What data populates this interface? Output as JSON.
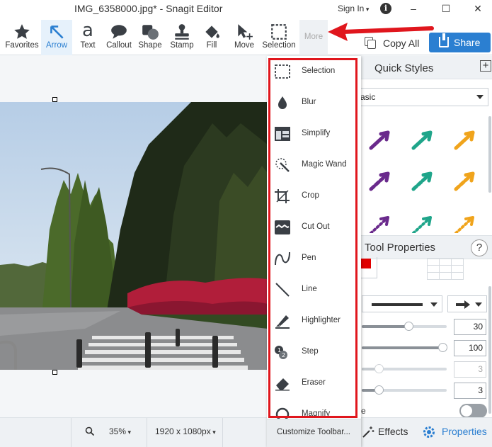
{
  "window": {
    "title": "IMG_6358000.jpg* - Snagit Editor",
    "sign_in": "Sign In"
  },
  "toolbar": {
    "tools": [
      {
        "label": "Favorites",
        "icon": "star-icon"
      },
      {
        "label": "Arrow",
        "icon": "arrow-icon"
      },
      {
        "label": "Text",
        "icon": "text-icon"
      },
      {
        "label": "Callout",
        "icon": "callout-icon"
      },
      {
        "label": "Shape",
        "icon": "shape-icon"
      },
      {
        "label": "Stamp",
        "icon": "stamp-icon"
      },
      {
        "label": "Fill",
        "icon": "fill-icon"
      },
      {
        "label": "Move",
        "icon": "move-icon"
      },
      {
        "label": "Selection",
        "icon": "selection-icon"
      },
      {
        "label": "More",
        "icon": "more-icon"
      }
    ],
    "copy_all": "Copy All",
    "share": "Share"
  },
  "more_menu": {
    "items": [
      {
        "label": "Selection",
        "icon": "selection-icon"
      },
      {
        "label": "Blur",
        "icon": "blur-icon"
      },
      {
        "label": "Simplify",
        "icon": "simplify-icon"
      },
      {
        "label": "Magic Wand",
        "icon": "magic-wand-icon"
      },
      {
        "label": "Crop",
        "icon": "crop-icon"
      },
      {
        "label": "Cut Out",
        "icon": "cut-out-icon"
      },
      {
        "label": "Pen",
        "icon": "pen-icon"
      },
      {
        "label": "Line",
        "icon": "line-icon"
      },
      {
        "label": "Highlighter",
        "icon": "highlighter-icon"
      },
      {
        "label": "Step",
        "icon": "step-icon"
      },
      {
        "label": "Eraser",
        "icon": "eraser-icon"
      },
      {
        "label": "Magnify",
        "icon": "magnify-icon"
      }
    ],
    "customize": "Customize Toolbar..."
  },
  "quick_styles": {
    "title": "Quick Styles",
    "theme": "asic",
    "colors": {
      "purple": "#6a2a8c",
      "green": "#1fa58a",
      "orange": "#f0a41c"
    }
  },
  "tool_properties": {
    "title": "Tool Properties",
    "help": "?",
    "color": "#e00000",
    "values": {
      "width": "30",
      "opacity": "100",
      "disabled_value": "3",
      "last_value": "3"
    },
    "toggle_label": "e"
  },
  "status": {
    "zoom": "35%",
    "dimensions": "1920 x 1080px",
    "effects": "Effects",
    "properties": "Properties"
  },
  "accent": "#2b7fd1",
  "highlight": "#e0161d"
}
